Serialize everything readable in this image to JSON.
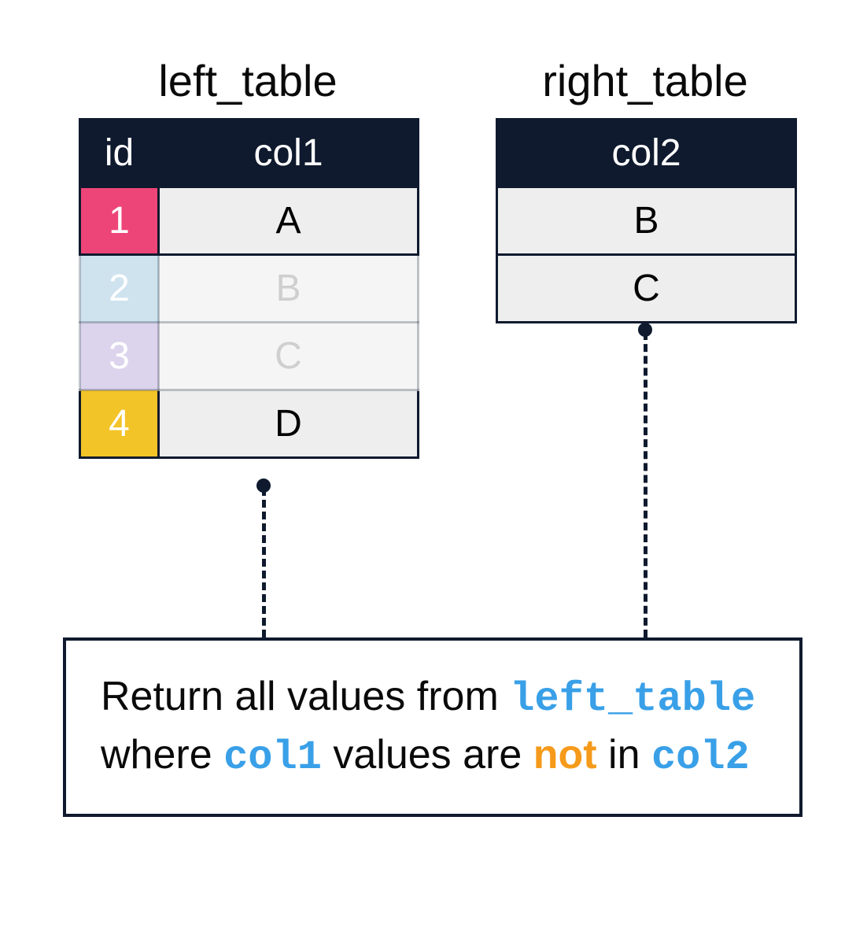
{
  "left_table": {
    "title": "left_table",
    "headers": {
      "id": "id",
      "col1": "col1"
    },
    "rows": [
      {
        "id": "1",
        "val": "A"
      },
      {
        "id": "2",
        "val": "B"
      },
      {
        "id": "3",
        "val": "C"
      },
      {
        "id": "4",
        "val": "D"
      }
    ]
  },
  "right_table": {
    "title": "right_table",
    "headers": {
      "col2": "col2"
    },
    "rows": [
      {
        "val": "B"
      },
      {
        "val": "C"
      }
    ]
  },
  "caption": {
    "t1": "Return all values from ",
    "code_left": "left_table",
    "t2": " where ",
    "code_col1": "col1",
    "t3": " values are ",
    "not": "not",
    "t4": " in ",
    "code_col2": "col2"
  }
}
